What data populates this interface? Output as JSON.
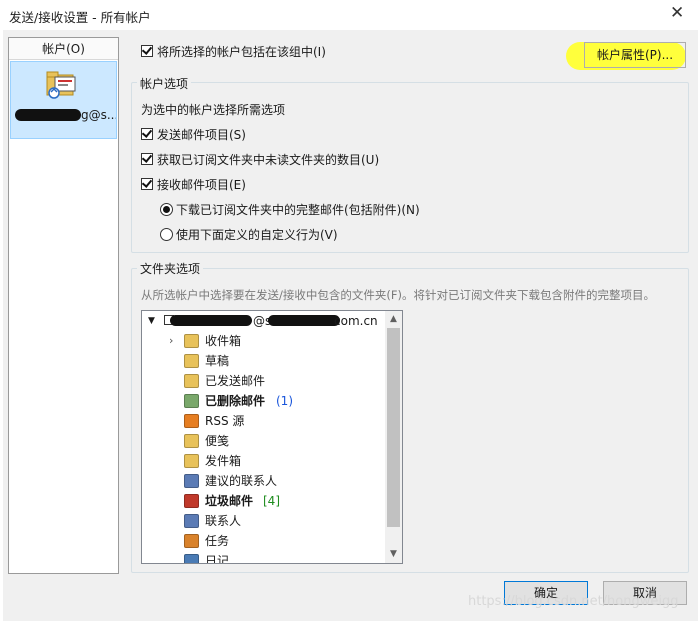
{
  "window": {
    "title": "发送/接收设置 - 所有帐户",
    "close_glyph": "✕"
  },
  "accounts": {
    "header": "帐户(O)",
    "selected_account_suffix": "g@s..."
  },
  "include_group_checkbox": {
    "label": "将所选择的帐户包括在该组中(I)",
    "checked": true
  },
  "account_properties_button": "帐户属性(P)...",
  "account_options": {
    "title": "帐户选项",
    "subtitle": "为选中的帐户选择所需选项",
    "send_items": "发送邮件项目(S)",
    "get_unread_count": "获取已订阅文件夹中未读文件夹的数目(U)",
    "receive_items": "接收邮件项目(E)",
    "radio_download_complete": "下载已订阅文件夹中的完整邮件(包括附件)(N)",
    "radio_custom": "使用下面定义的自定义行为(V)"
  },
  "folder_options": {
    "title": "文件夹选项",
    "description": "从所选帐户中选择要在发送/接收中包含的文件夹(F)。将针对已订阅文件夹下载包含附件的完整项目。",
    "root_suffix": "com.cn",
    "root_at": "@s",
    "folders": [
      {
        "name": "收件箱",
        "bold": false,
        "count": "",
        "icon": "inbox-folder-icon",
        "expander": true
      },
      {
        "name": "草稿",
        "bold": false,
        "count": "",
        "icon": "drafts-folder-icon",
        "expander": false
      },
      {
        "name": "已发送邮件",
        "bold": false,
        "count": "",
        "icon": "sent-folder-icon",
        "expander": false
      },
      {
        "name": "已删除邮件",
        "bold": true,
        "count": "(1)",
        "icon": "trash-folder-icon",
        "expander": false
      },
      {
        "name": "RSS 源",
        "bold": false,
        "count": "",
        "icon": "rss-folder-icon",
        "expander": false
      },
      {
        "name": "便笺",
        "bold": false,
        "count": "",
        "icon": "notes-folder-icon",
        "expander": false
      },
      {
        "name": "发件箱",
        "bold": false,
        "count": "",
        "icon": "outbox-folder-icon",
        "expander": false
      },
      {
        "name": "建议的联系人",
        "bold": false,
        "count": "",
        "icon": "suggested-contacts-icon",
        "expander": false
      },
      {
        "name": "垃圾邮件",
        "bold": true,
        "count": "[4]",
        "icon": "junk-folder-icon",
        "expander": false
      },
      {
        "name": "联系人",
        "bold": false,
        "count": "",
        "icon": "contacts-folder-icon",
        "expander": false
      },
      {
        "name": "任务",
        "bold": false,
        "count": "",
        "icon": "tasks-folder-icon",
        "expander": false
      },
      {
        "name": "日记",
        "bold": false,
        "count": "",
        "icon": "journal-folder-icon",
        "expander": false
      }
    ]
  },
  "buttons": {
    "ok": "确定",
    "cancel": "取消"
  },
  "watermark": "https://blog.csdn.net/hongweigg",
  "colors": {
    "highlight": "#ffff3c",
    "selection": "#cce8ff",
    "count_blue": "#1a56db",
    "count_green": "#1e8c1e"
  }
}
